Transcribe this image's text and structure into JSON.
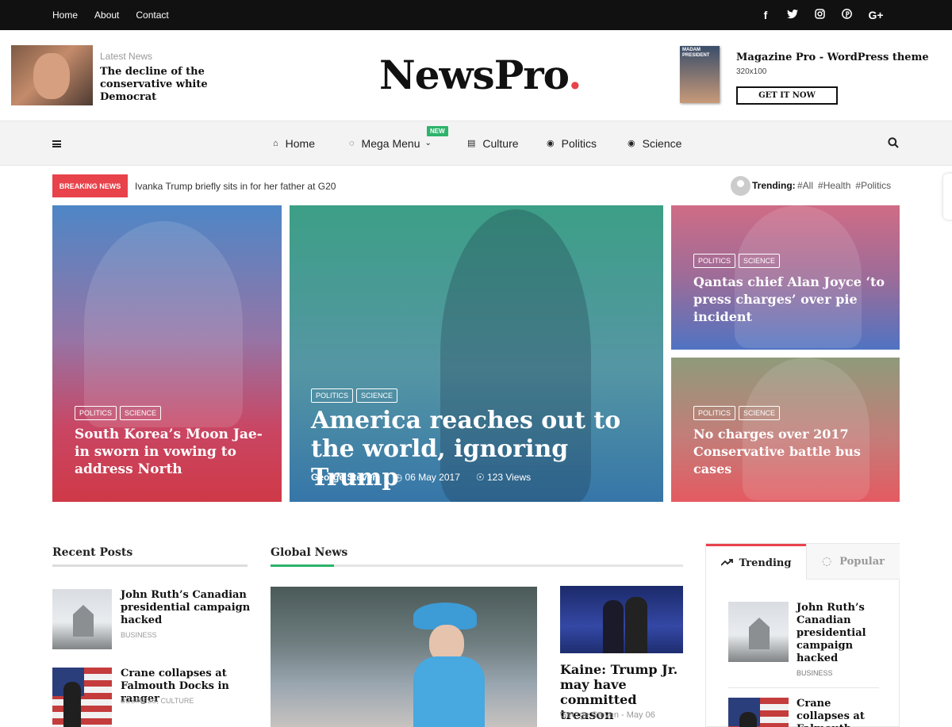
{
  "topbar": {
    "nav": [
      "Home",
      "About",
      "Contact"
    ],
    "social": [
      "facebook-icon",
      "twitter-icon",
      "instagram-icon",
      "pinterest-icon",
      "google-plus-icon"
    ],
    "social_glyphs": [
      "f",
      "t",
      "◎",
      "P",
      "G+"
    ]
  },
  "header": {
    "latest_label": "Latest News",
    "latest_title": "The decline of the conservative white Democrat",
    "logo_text": "NewsPro",
    "logo_dot": ".",
    "ad_cover_text": "MADAM PRESIDENT",
    "ad_title": "Magazine Pro - WordPress theme",
    "ad_size": "320x100",
    "ad_button": "GET IT NOW"
  },
  "mainnav": {
    "items": [
      {
        "label": "Home",
        "icon": "home-icon"
      },
      {
        "label": "Mega Menu",
        "icon": "fire-icon",
        "badge": "NEW"
      },
      {
        "label": "Culture",
        "icon": "bank-icon"
      },
      {
        "label": "Politics",
        "icon": "globe-icon"
      },
      {
        "label": "Science",
        "icon": "globe-icon"
      }
    ]
  },
  "breaking": {
    "label": "BREAKING NEWS",
    "text": "Ivanka Trump briefly sits in for her father at G20",
    "trending_label": "Trending:",
    "tags": [
      "#All",
      "#Health",
      "#Politics"
    ]
  },
  "hero": {
    "cards": [
      {
        "tags": [
          "POLITICS",
          "SCIENCE"
        ],
        "title": "South Korea’s Moon Jae-in sworn in vowing to address North"
      },
      {
        "tags": [
          "POLITICS",
          "SCIENCE"
        ],
        "title": "America reaches out to the world, ignoring Trump",
        "author": "George Steven",
        "date": "06 May 2017",
        "views": "123 Views"
      },
      {
        "tags": [
          "POLITICS",
          "SCIENCE"
        ],
        "title": "Qantas chief Alan Joyce ‘to press charges’ over pie incident"
      },
      {
        "tags": [
          "POLITICS",
          "SCIENCE"
        ],
        "title": "No charges over 2017 Conservative battle bus cases"
      }
    ]
  },
  "recent": {
    "title": "Recent Posts",
    "posts": [
      {
        "title": "John Ruth’s Canadian presidential campaign hacked",
        "category": "BUSINESS"
      },
      {
        "title": "Crane collapses at Falmouth Docks in ranger",
        "category": "BUSINESS, CULTURE"
      }
    ]
  },
  "global": {
    "title": "Global News",
    "side_title": "Kaine: Trump Jr. may have committed treason",
    "side_meta": "George Steven - May 06"
  },
  "widget": {
    "tab_trending": "Trending",
    "tab_popular": "Popular",
    "posts": [
      {
        "title": "John Ruth’s Canadian presidential campaign hacked",
        "category": "BUSINESS"
      },
      {
        "title": "Crane collapses at Falmouth Docks in ranger",
        "category": ""
      }
    ]
  },
  "colors": {
    "accent": "#e8424b",
    "new_badge": "#2db36b",
    "global_accent": "#2db36b"
  }
}
